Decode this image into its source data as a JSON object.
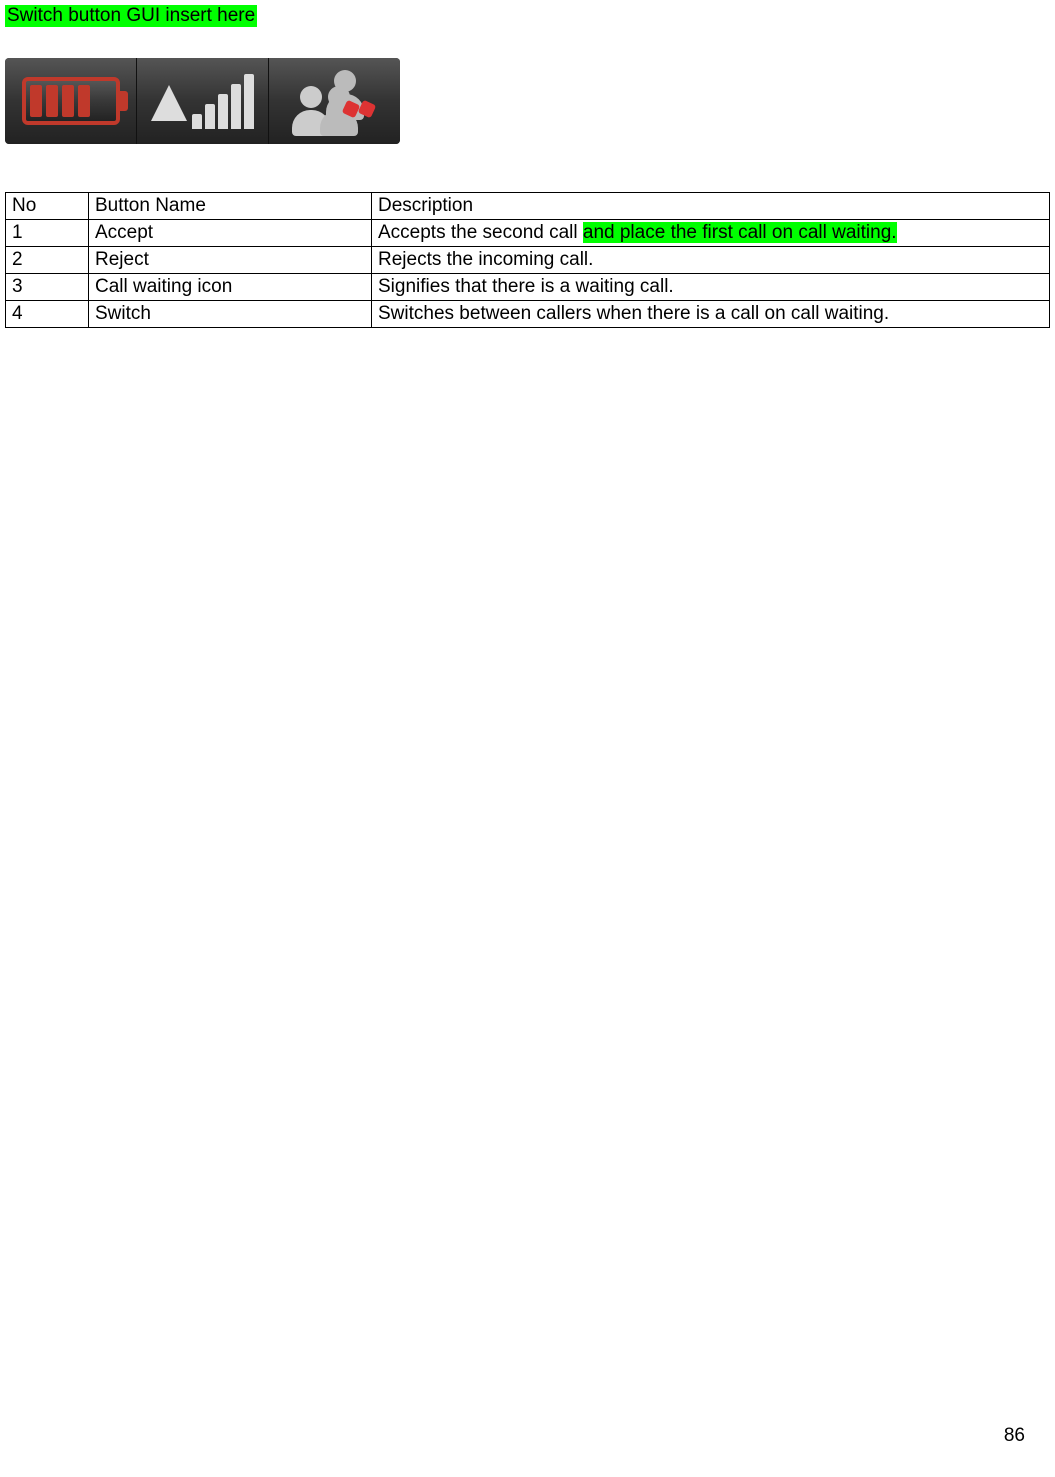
{
  "header_note": "Switch button GUI insert here",
  "icons": {
    "battery": "battery-icon",
    "signal": "signal-icon",
    "people": "call-waiting-icon"
  },
  "table": {
    "headers": {
      "no": "No",
      "button_name": "Button Name",
      "description": "Description"
    },
    "rows": [
      {
        "no": "1",
        "button_name": "Accept",
        "desc_prefix": "Accepts the second call ",
        "desc_highlight": "and place the first call on call waiting."
      },
      {
        "no": "2",
        "button_name": "Reject",
        "description": "Rejects the incoming call."
      },
      {
        "no": "3",
        "button_name": "Call waiting icon",
        "description": "Signifies that there is a waiting call."
      },
      {
        "no": "4",
        "button_name": "Switch",
        "description": "Switches between callers when there is a call on call waiting."
      }
    ]
  },
  "page_number": "86"
}
